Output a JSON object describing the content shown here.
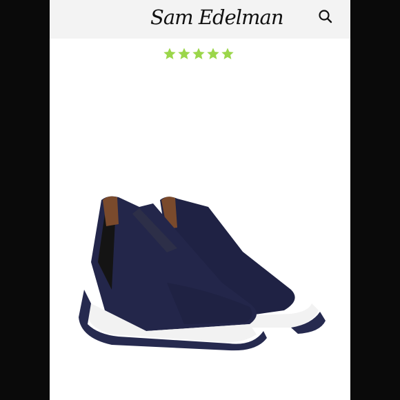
{
  "header": {
    "brand_logo_text": "Sam Edelman",
    "search_icon": "search-icon"
  },
  "rating": {
    "value": 5,
    "max": 5,
    "color": "#9bd64a"
  },
  "product_image": {
    "description_icon": "sneaker-image",
    "colors": {
      "knit": "#23264a",
      "sole": "#262a4f",
      "midsole": "#f2f2f2",
      "heel_pull": "#7a4a2c"
    }
  }
}
